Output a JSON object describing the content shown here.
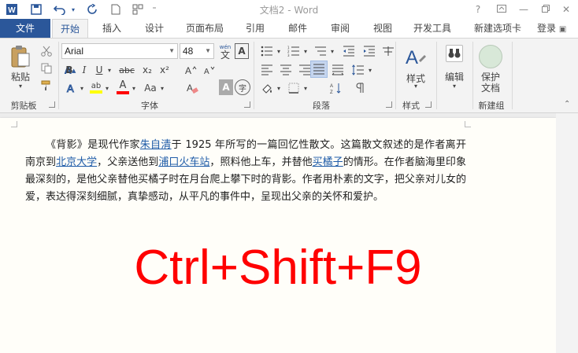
{
  "title_bar": {
    "title": "文档2 - Word",
    "help": "?"
  },
  "tabs": {
    "file": "文件",
    "items": [
      "开始",
      "插入",
      "设计",
      "页面布局",
      "引用",
      "邮件",
      "审阅",
      "视图",
      "开发工具",
      "新建选项卡"
    ],
    "active_index": 0,
    "login": "登录"
  },
  "ribbon": {
    "clipboard": {
      "label": "剪贴板",
      "paste": "粘贴"
    },
    "font": {
      "label": "字体",
      "name": "Arial",
      "size": "48",
      "wen": "wén",
      "wen_char": "文",
      "a_box": "A",
      "bold": "B",
      "italic": "I",
      "underline": "U",
      "strike": "abc",
      "subscript": "x₂",
      "superscript": "x²",
      "font_color": "A",
      "aa": "Aa",
      "a_gray": "A",
      "zi": "字"
    },
    "paragraph": {
      "label": "段落"
    },
    "styles": {
      "label": "样式",
      "button": "样式"
    },
    "editing": {
      "button": "编辑"
    },
    "new_group": {
      "label": "新建组",
      "protect": "保护",
      "protect2": "文档"
    }
  },
  "document": {
    "seg1": "《背影》是现代作家",
    "link_author": "朱自清",
    "seg2": "于 1925 年所写的一篇回忆性散文。这篇散文叙述的是作者离开南京到",
    "link_university": "北京大学",
    "seg3": "，父亲送他到",
    "link_station": "浦口火车站",
    "seg4": "，照料他上车，并替他",
    "link_oranges": "买橘子",
    "seg5": "的情形。在作者脑海里印象最深刻的，是他父亲替他买橘子时在月台爬上攀下时的背影。作者用朴素的文字，把父亲对儿女的爱，表达得深刻细腻，真挚感动，从平凡的事件中，呈现出父亲的关怀和爱护。",
    "shortcut": "Ctrl+Shift+F9"
  },
  "colors": {
    "accent": "#2b579a",
    "link": "#1f5ca8",
    "shortcut": "#ff0000",
    "highlight": "#ffff00",
    "font_color_bar": "#ff0000"
  }
}
